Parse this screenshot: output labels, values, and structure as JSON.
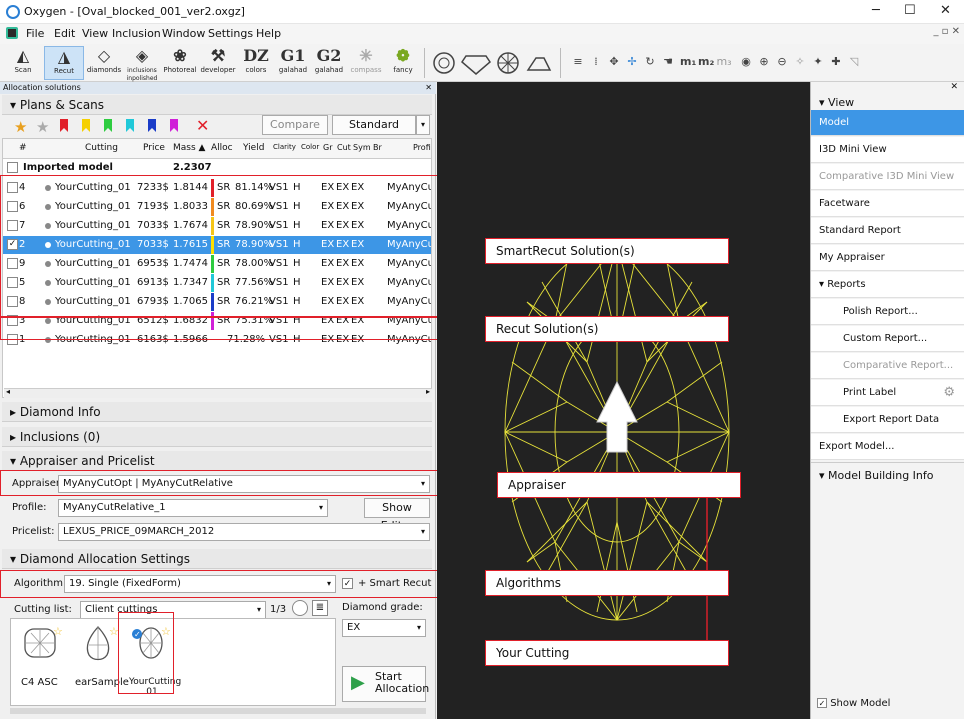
{
  "window": {
    "title": "Oxygen - [Oval_blocked_001_ver2.oxgz]"
  },
  "menu": [
    "File",
    "Edit",
    "View",
    "Inclusion",
    "Window",
    "Settings",
    "Help"
  ],
  "toolbar": [
    {
      "label": "Scan",
      "icon": "scan-icon",
      "glyph": "◭"
    },
    {
      "label": "Recut",
      "icon": "recut-icon",
      "glyph": "◮"
    },
    {
      "label": "diamonds",
      "icon": "diamonds-icon",
      "glyph": "◇"
    },
    {
      "label": "inclusions inpolished",
      "icon": "inclusions-icon",
      "glyph": "◈"
    },
    {
      "label": "Photoreal",
      "icon": "photoreal-icon",
      "glyph": "❀"
    },
    {
      "label": "developer",
      "icon": "developer-icon",
      "glyph": "⚒"
    },
    {
      "label": "colors",
      "icon": "colors-icon",
      "glyph": "DZ"
    },
    {
      "label": "galahad",
      "icon": "galahad-g1-icon",
      "glyph": "G1"
    },
    {
      "label": "galahad",
      "icon": "galahad-g2-icon",
      "glyph": "G2"
    },
    {
      "label": "compass",
      "icon": "compass-icon",
      "glyph": "✳"
    },
    {
      "label": "fancy",
      "icon": "fancy-icon",
      "glyph": "❁"
    }
  ],
  "panel": {
    "title": "Allocation solutions",
    "plans_header": "Plans & Scans",
    "compare_label": "Compare",
    "standard_report_label": "Standard Report",
    "columns": [
      "#",
      "Cutting",
      "Price",
      "Mass ▲",
      "Alloc",
      "Yield",
      "Clarity",
      "Color",
      "Gr",
      "Cut",
      "Sym",
      "Br",
      "Profile"
    ],
    "imported_label": "Imported model",
    "imported_mass": "2.2307",
    "rows": [
      {
        "num": "4",
        "cutting": "YourCutting_01",
        "price": "7233$",
        "mass": "1.8144",
        "alloc": "SR",
        "yield": "81.14%",
        "clarity": "VS1",
        "color": "H",
        "gr": "EX",
        "cut": "EX",
        "sym": "EX",
        "profile": "MyAnyCutR",
        "bar": "#e1202a",
        "checked": false
      },
      {
        "num": "6",
        "cutting": "YourCutting_01",
        "price": "7193$",
        "mass": "1.8033",
        "alloc": "SR",
        "yield": "80.69%",
        "clarity": "VS1",
        "color": "H",
        "gr": "EX",
        "cut": "EX",
        "sym": "EX",
        "profile": "MyAnyCutR",
        "bar": "#f08a20",
        "checked": false
      },
      {
        "num": "7",
        "cutting": "YourCutting_01",
        "price": "7033$",
        "mass": "1.7674",
        "alloc": "SR",
        "yield": "78.90%",
        "clarity": "VS1",
        "color": "H",
        "gr": "EX",
        "cut": "EX",
        "sym": "EX",
        "profile": "MyAnyCutR",
        "bar": "#f5c518",
        "checked": false
      },
      {
        "num": "2",
        "cutting": "YourCutting_01",
        "price": "7033$",
        "mass": "1.7615",
        "alloc": "SR",
        "yield": "78.90%",
        "clarity": "VS1",
        "color": "H",
        "gr": "EX",
        "cut": "EX",
        "sym": "EX",
        "profile": "MyAnyCutR",
        "bar": "#ffe000",
        "checked": true
      },
      {
        "num": "9",
        "cutting": "YourCutting_01",
        "price": "6953$",
        "mass": "1.7474",
        "alloc": "SR",
        "yield": "78.00%",
        "clarity": "VS1",
        "color": "H",
        "gr": "EX",
        "cut": "EX",
        "sym": "EX",
        "profile": "MyAnyCutR",
        "bar": "#2ecc40",
        "checked": false
      },
      {
        "num": "5",
        "cutting": "YourCutting_01",
        "price": "6913$",
        "mass": "1.7347",
        "alloc": "SR",
        "yield": "77.56%",
        "clarity": "VS1",
        "color": "H",
        "gr": "EX",
        "cut": "EX",
        "sym": "EX",
        "profile": "MyAnyCutR",
        "bar": "#20c8d8",
        "checked": false
      },
      {
        "num": "8",
        "cutting": "YourCutting_01",
        "price": "6793$",
        "mass": "1.7065",
        "alloc": "SR",
        "yield": "76.21%",
        "clarity": "VS1",
        "color": "H",
        "gr": "EX",
        "cut": "EX",
        "sym": "EX",
        "profile": "MyAnyCutR",
        "bar": "#1a3cc8",
        "checked": false
      },
      {
        "num": "3",
        "cutting": "YourCutting_01",
        "price": "6512$",
        "mass": "1.6832",
        "alloc": "SR",
        "yield": "75.31%",
        "clarity": "VS1",
        "color": "H",
        "gr": "EX",
        "cut": "EX",
        "sym": "EX",
        "profile": "MyAnyCutR",
        "bar": "#d020d8",
        "checked": false
      },
      {
        "num": "1",
        "cutting": "YourCutting_01",
        "price": "6163$",
        "mass": "1.5966",
        "alloc": "",
        "yield": "71.28%",
        "clarity": "VS1",
        "color": "H",
        "gr": "EX",
        "cut": "EX",
        "sym": "EX",
        "profile": "MyAnyCutR",
        "bar": "",
        "checked": false
      }
    ],
    "diamond_info": "Diamond Info",
    "inclusions": "Inclusions (0)",
    "appraiser_header": "Appraiser and Pricelist",
    "appraiser_label": "Appraiser:",
    "appraiser_value": "MyAnyCutOpt | MyAnyCutRelative",
    "profile_label": "Profile:",
    "profile_value": "MyAnyCutRelative_1",
    "show_editor": "Show Editor",
    "pricelist_label": "Pricelist:",
    "pricelist_value": "LEXUS_PRICE_09MARCH_2012",
    "alloc_header": "Diamond Allocation Settings",
    "algorithm_label": "Algorithm:",
    "algorithm_value": "19. Single (FixedForm)",
    "smart_recut": "+ Smart Recut",
    "cutting_list_label": "Cutting list:",
    "cutting_list_value": "Client cuttings",
    "page_indicator": "1/3",
    "diamond_grade_label": "Diamond grade:",
    "diamond_grade_value": "EX",
    "cuttings": [
      "C4 ASC",
      "earSample",
      "YourCutting 01"
    ],
    "start_allocation": "Start Allocation"
  },
  "callouts": {
    "smartrecut": "SmartRecut Solution(s)",
    "recut": "Recut Solution(s)",
    "appraiser": "Appraiser",
    "algorithms": "Algorithms",
    "your_cutting": "Your Cutting"
  },
  "right_panel": {
    "view_header": "View",
    "items": [
      "Model",
      "I3D Mini View",
      "Comparative I3D Mini View",
      "Facetware",
      "Standard Report",
      "My Appraiser"
    ],
    "reports_header": "Reports",
    "reports": [
      "Polish Report...",
      "Custom Report...",
      "Comparative Report...",
      "Print Label",
      "Export Report Data"
    ],
    "export_model": "Export Model...",
    "model_building": "Model Building Info",
    "show_model": "Show Model"
  }
}
